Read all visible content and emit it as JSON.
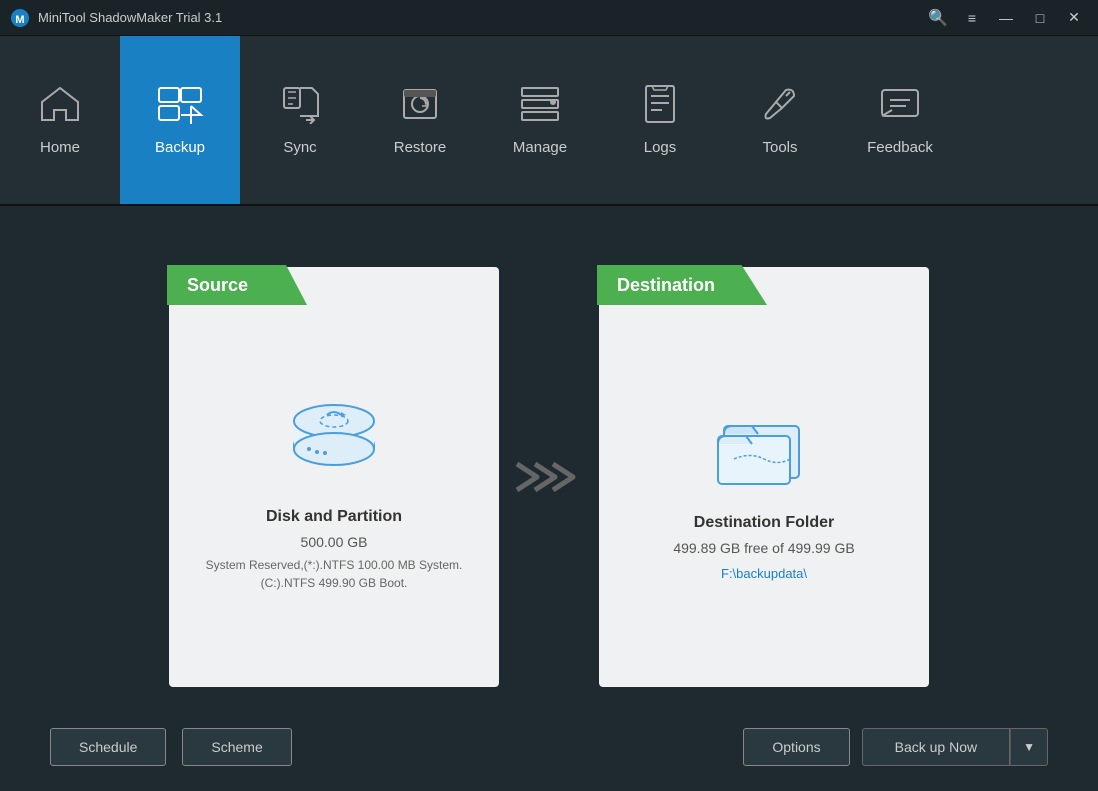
{
  "titlebar": {
    "title": "MiniTool ShadowMaker Trial 3.1",
    "logo": "M",
    "search_icon": "🔍",
    "menu_icon": "≡",
    "minimize": "—",
    "maximize": "□",
    "close": "✕"
  },
  "nav": {
    "items": [
      {
        "id": "home",
        "label": "Home",
        "active": false
      },
      {
        "id": "backup",
        "label": "Backup",
        "active": true
      },
      {
        "id": "sync",
        "label": "Sync",
        "active": false
      },
      {
        "id": "restore",
        "label": "Restore",
        "active": false
      },
      {
        "id": "manage",
        "label": "Manage",
        "active": false
      },
      {
        "id": "logs",
        "label": "Logs",
        "active": false
      },
      {
        "id": "tools",
        "label": "Tools",
        "active": false
      },
      {
        "id": "feedback",
        "label": "Feedback",
        "active": false
      }
    ]
  },
  "source_card": {
    "header": "Source",
    "title": "Disk and Partition",
    "size": "500.00 GB",
    "detail": "System Reserved,(*:).NTFS 100.00 MB System. (C:).NTFS 499.90 GB Boot."
  },
  "destination_card": {
    "header": "Destination",
    "title": "Destination Folder",
    "free": "499.89 GB free of 499.99 GB",
    "path": "F:\\backupdata\\"
  },
  "buttons": {
    "schedule": "Schedule",
    "scheme": "Scheme",
    "options": "Options",
    "backup_now": "Back up Now"
  }
}
